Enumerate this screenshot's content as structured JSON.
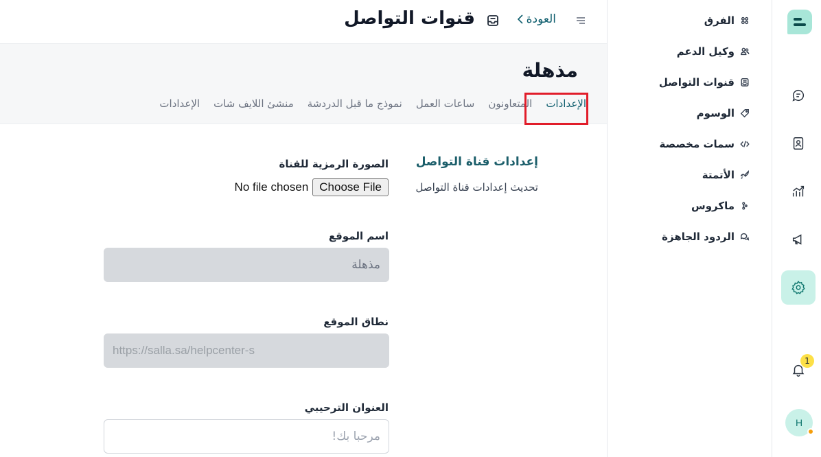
{
  "header": {
    "title": "قنوات التواصل",
    "back_label": "العودة"
  },
  "inbox": {
    "name": "مذهلة",
    "tabs": [
      {
        "label": "الإعدادات",
        "active": true
      },
      {
        "label": "المتعاونون",
        "active": false
      },
      {
        "label": "ساعات العمل",
        "active": false
      },
      {
        "label": "نموذج ما قبل الدردشة",
        "active": false
      },
      {
        "label": "منشئ اللايف شات",
        "active": false
      },
      {
        "label": "الإعدادات",
        "active": false
      }
    ]
  },
  "sidebar": {
    "items": [
      {
        "label": "الفرق",
        "icon": "teams-icon"
      },
      {
        "label": "وكيل الدعم",
        "icon": "agents-icon"
      },
      {
        "label": "قنوات التواصل",
        "icon": "inbox-icon"
      },
      {
        "label": "الوسوم",
        "icon": "tag-icon"
      },
      {
        "label": "سمات مخصصة",
        "icon": "code-icon"
      },
      {
        "label": "الأتمتة",
        "icon": "rocket-icon"
      },
      {
        "label": "ماكروس",
        "icon": "macro-icon"
      },
      {
        "label": "الردود الجاهزة",
        "icon": "chat-bubbles-icon"
      }
    ]
  },
  "rail": {
    "notifications_count": "1",
    "avatar_initial": "H"
  },
  "settings": {
    "section_title": "إعدادات قناة التواصل",
    "section_description": "تحديث إعدادات قناة التواصل",
    "avatar_label": "الصورة الرمزية للقناة",
    "file_button": "Choose File",
    "file_status": "No file chosen",
    "website_name_label": "اسم الموقع",
    "website_name_value": "مذهلة",
    "website_domain_label": "نطاق الموقع",
    "website_domain_value": "https://salla.sa/helpcenter-s",
    "welcome_heading_label": "العنوان الترحيبي",
    "welcome_heading_placeholder": "مرحبا بك!"
  },
  "colors": {
    "accent": "#0f5e6e",
    "active_rail_bg": "#c9f1e8",
    "highlight": "#e11d2a"
  }
}
